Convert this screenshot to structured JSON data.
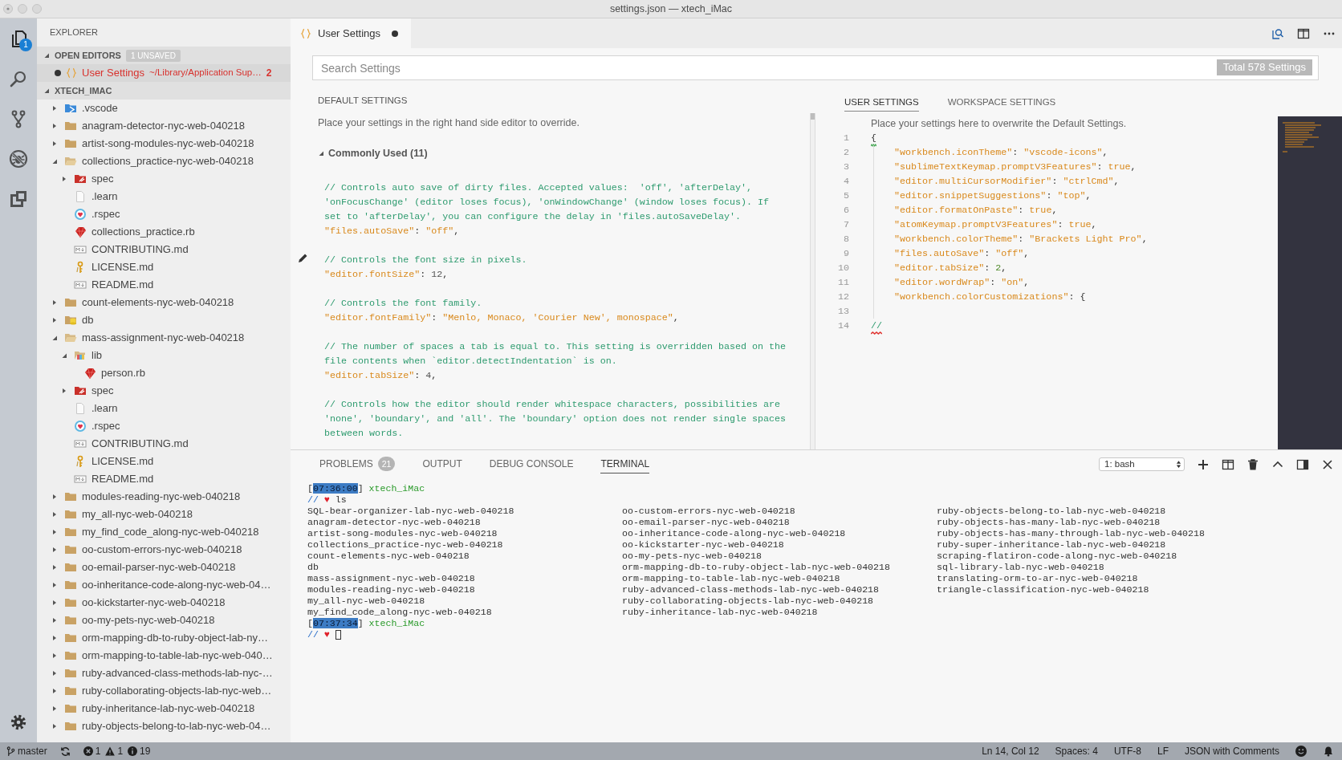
{
  "window": {
    "title": "settings.json — xtech_iMac"
  },
  "activity_bar": {
    "items": [
      {
        "kind": "explorer",
        "selected": true,
        "badge": "1"
      },
      {
        "kind": "search",
        "selected": false
      },
      {
        "kind": "source-control",
        "selected": false
      },
      {
        "kind": "debug",
        "selected": false
      },
      {
        "kind": "extensions",
        "selected": false
      }
    ]
  },
  "sidebar": {
    "title": "EXPLORER",
    "open_editors": {
      "label": "OPEN EDITORS",
      "expanded": true,
      "badge": "1 UNSAVED",
      "items": [
        {
          "name": "User Settings",
          "path": "~/Library/Application Sup…",
          "problems": "2",
          "dirty": true,
          "selected": true
        }
      ]
    },
    "folder": {
      "label": "XTECH_IMAC",
      "expanded": true,
      "items": [
        {
          "name": ".vscode",
          "kind": "vscode-folder",
          "expanded": false
        },
        {
          "name": "anagram-detector-nyc-web-040218",
          "kind": "folder",
          "expanded": false
        },
        {
          "name": "artist-song-modules-nyc-web-040218",
          "kind": "folder",
          "expanded": false
        },
        {
          "name": "collections_practice-nyc-web-040218",
          "kind": "folder",
          "expanded": true,
          "children": [
            {
              "name": "spec",
              "kind": "spec-folder",
              "expanded": false
            },
            {
              "name": ".learn",
              "kind": "file"
            },
            {
              "name": ".rspec",
              "kind": "rspec"
            },
            {
              "name": "collections_practice.rb",
              "kind": "ruby"
            },
            {
              "name": "CONTRIBUTING.md",
              "kind": "markdown"
            },
            {
              "name": "LICENSE.md",
              "kind": "license"
            },
            {
              "name": "README.md",
              "kind": "markdown"
            }
          ]
        },
        {
          "name": "count-elements-nyc-web-040218",
          "kind": "folder",
          "expanded": false
        },
        {
          "name": "db",
          "kind": "db-folder",
          "expanded": false
        },
        {
          "name": "mass-assignment-nyc-web-040218",
          "kind": "folder",
          "expanded": true,
          "children": [
            {
              "name": "lib",
              "kind": "lib-folder",
              "expanded": true,
              "children": [
                {
                  "name": "person.rb",
                  "kind": "ruby"
                }
              ]
            },
            {
              "name": "spec",
              "kind": "spec-folder",
              "expanded": false
            },
            {
              "name": ".learn",
              "kind": "file"
            },
            {
              "name": ".rspec",
              "kind": "rspec"
            },
            {
              "name": "CONTRIBUTING.md",
              "kind": "markdown"
            },
            {
              "name": "LICENSE.md",
              "kind": "license"
            },
            {
              "name": "README.md",
              "kind": "markdown"
            }
          ]
        },
        {
          "name": "modules-reading-nyc-web-040218",
          "kind": "folder",
          "expanded": false
        },
        {
          "name": "my_all-nyc-web-040218",
          "kind": "folder",
          "expanded": false
        },
        {
          "name": "my_find_code_along-nyc-web-040218",
          "kind": "folder",
          "expanded": false
        },
        {
          "name": "oo-custom-errors-nyc-web-040218",
          "kind": "folder",
          "expanded": false
        },
        {
          "name": "oo-email-parser-nyc-web-040218",
          "kind": "folder",
          "expanded": false
        },
        {
          "name": "oo-inheritance-code-along-nyc-web-04…",
          "kind": "folder",
          "expanded": false
        },
        {
          "name": "oo-kickstarter-nyc-web-040218",
          "kind": "folder",
          "expanded": false
        },
        {
          "name": "oo-my-pets-nyc-web-040218",
          "kind": "folder",
          "expanded": false
        },
        {
          "name": "orm-mapping-db-to-ruby-object-lab-ny…",
          "kind": "folder",
          "expanded": false
        },
        {
          "name": "orm-mapping-to-table-lab-nyc-web-040…",
          "kind": "folder",
          "expanded": false
        },
        {
          "name": "ruby-advanced-class-methods-lab-nyc-…",
          "kind": "folder",
          "expanded": false
        },
        {
          "name": "ruby-collaborating-objects-lab-nyc-web…",
          "kind": "folder",
          "expanded": false
        },
        {
          "name": "ruby-inheritance-lab-nyc-web-040218",
          "kind": "folder",
          "expanded": false
        },
        {
          "name": "ruby-objects-belong-to-lab-nyc-web-04…",
          "kind": "folder",
          "expanded": false
        }
      ]
    }
  },
  "editor": {
    "tabs": [
      {
        "label": "User Settings",
        "dirty": true,
        "selected": true
      }
    ],
    "search": {
      "placeholder": "Search Settings",
      "count": "Total 578 Settings"
    },
    "default_settings": {
      "title": "DEFAULT SETTINGS",
      "hint": "Place your settings in the right hand side editor to override.",
      "group": {
        "label": "Commonly Used (11)",
        "expanded": true
      },
      "blocks": [
        {
          "comment": [
            "// Controls auto save of dirty files. Accepted values:  'off', 'afterDelay',",
            "'onFocusChange' (editor loses focus), 'onWindowChange' (window loses focus). If",
            "set to 'afterDelay', you can configure the delay in 'files.autoSaveDelay'."
          ],
          "setting": [
            {
              "kind": "key",
              "text": "\"files.autoSave\""
            },
            {
              "kind": "punct",
              "text": ": "
            },
            {
              "kind": "string",
              "text": "\"off\""
            },
            {
              "kind": "punct",
              "text": ","
            }
          ]
        },
        {
          "comment": [
            "// Controls the font size in pixels."
          ],
          "setting": [
            {
              "kind": "key",
              "text": "\"editor.fontSize\""
            },
            {
              "kind": "punct",
              "text": ": "
            },
            {
              "kind": "plain",
              "text": "12"
            },
            {
              "kind": "punct",
              "text": ","
            }
          ]
        },
        {
          "comment": [
            "// Controls the font family."
          ],
          "setting": [
            {
              "kind": "key",
              "text": "\"editor.fontFamily\""
            },
            {
              "kind": "punct",
              "text": ": "
            },
            {
              "kind": "string",
              "text": "\"Menlo, Monaco, 'Courier New', monospace\""
            },
            {
              "kind": "punct",
              "text": ","
            }
          ]
        },
        {
          "comment": [
            "// The number of spaces a tab is equal to. This setting is overridden based on the",
            "file contents when `editor.detectIndentation` is on."
          ],
          "setting": [
            {
              "kind": "key",
              "text": "\"editor.tabSize\""
            },
            {
              "kind": "punct",
              "text": ": "
            },
            {
              "kind": "plain",
              "text": "4"
            },
            {
              "kind": "punct",
              "text": ","
            }
          ]
        },
        {
          "comment": [
            "// Controls how the editor should render whitespace characters, possibilities are",
            "'none', 'boundary', and 'all'. The 'boundary' option does not render single spaces",
            "between words."
          ]
        }
      ]
    },
    "user_settings": {
      "tabs": [
        {
          "label": "USER SETTINGS",
          "selected": true
        },
        {
          "label": "WORKSPACE SETTINGS",
          "selected": false
        }
      ],
      "hint": "Place your settings here to overwrite the Default Settings.",
      "lines": [
        {
          "number": "1",
          "indented": false,
          "tokens": [
            {
              "kind": "punct",
              "text": "{",
              "warning": true
            }
          ]
        },
        {
          "number": "2",
          "indented": true,
          "tokens": [
            {
              "kind": "key",
              "text": "\"workbench.iconTheme\""
            },
            {
              "kind": "punct",
              "text": ": "
            },
            {
              "kind": "string",
              "text": "\"vscode-icons\""
            },
            {
              "kind": "punct",
              "text": ","
            }
          ]
        },
        {
          "number": "3",
          "indented": true,
          "tokens": [
            {
              "kind": "key",
              "text": "\"sublimeTextKeymap.promptV3Features\""
            },
            {
              "kind": "punct",
              "text": ": "
            },
            {
              "kind": "bool",
              "text": "true"
            },
            {
              "kind": "punct",
              "text": ","
            }
          ]
        },
        {
          "number": "4",
          "indented": true,
          "tokens": [
            {
              "kind": "key",
              "text": "\"editor.multiCursorModifier\""
            },
            {
              "kind": "punct",
              "text": ": "
            },
            {
              "kind": "string",
              "text": "\"ctrlCmd\""
            },
            {
              "kind": "punct",
              "text": ","
            }
          ]
        },
        {
          "number": "5",
          "indented": true,
          "tokens": [
            {
              "kind": "key",
              "text": "\"editor.snippetSuggestions\""
            },
            {
              "kind": "punct",
              "text": ": "
            },
            {
              "kind": "string",
              "text": "\"top\""
            },
            {
              "kind": "punct",
              "text": ","
            }
          ]
        },
        {
          "number": "6",
          "indented": true,
          "tokens": [
            {
              "kind": "key",
              "text": "\"editor.formatOnPaste\""
            },
            {
              "kind": "punct",
              "text": ": "
            },
            {
              "kind": "bool",
              "text": "true"
            },
            {
              "kind": "punct",
              "text": ","
            }
          ]
        },
        {
          "number": "7",
          "indented": true,
          "tokens": [
            {
              "kind": "key",
              "text": "\"atomKeymap.promptV3Features\""
            },
            {
              "kind": "punct",
              "text": ": "
            },
            {
              "kind": "bool",
              "text": "true"
            },
            {
              "kind": "punct",
              "text": ","
            }
          ]
        },
        {
          "number": "8",
          "indented": true,
          "tokens": [
            {
              "kind": "key",
              "text": "\"workbench.colorTheme\""
            },
            {
              "kind": "punct",
              "text": ": "
            },
            {
              "kind": "string",
              "text": "\"Brackets Light Pro\""
            },
            {
              "kind": "punct",
              "text": ","
            }
          ]
        },
        {
          "number": "9",
          "indented": true,
          "tokens": [
            {
              "kind": "key",
              "text": "\"files.autoSave\""
            },
            {
              "kind": "punct",
              "text": ": "
            },
            {
              "kind": "string",
              "text": "\"off\""
            },
            {
              "kind": "punct",
              "text": ","
            }
          ]
        },
        {
          "number": "10",
          "indented": true,
          "tokens": [
            {
              "kind": "key",
              "text": "\"editor.tabSize\""
            },
            {
              "kind": "punct",
              "text": ": "
            },
            {
              "kind": "number",
              "text": "2"
            },
            {
              "kind": "punct",
              "text": ","
            }
          ]
        },
        {
          "number": "11",
          "indented": true,
          "tokens": [
            {
              "kind": "key",
              "text": "\"editor.wordWrap\""
            },
            {
              "kind": "punct",
              "text": ": "
            },
            {
              "kind": "string",
              "text": "\"on\""
            },
            {
              "kind": "punct",
              "text": ","
            }
          ]
        },
        {
          "number": "12",
          "indented": true,
          "tokens": [
            {
              "kind": "key",
              "text": "\"workbench.colorCustomizations\""
            },
            {
              "kind": "punct",
              "text": ": {"
            }
          ]
        },
        {
          "number": "13"
        },
        {
          "number": "14",
          "indented": false,
          "tokens": [
            {
              "kind": "comment",
              "text": "//",
              "error": true
            }
          ]
        }
      ]
    }
  },
  "panel": {
    "tabs": [
      {
        "label": "PROBLEMS",
        "badge": "21",
        "selected": false
      },
      {
        "label": "OUTPUT",
        "selected": false
      },
      {
        "label": "DEBUG CONSOLE",
        "selected": false
      },
      {
        "label": "TERMINAL",
        "selected": true
      }
    ],
    "terminal_select": "1: bash",
    "terminal": [
      {
        "kind": "header",
        "open": "[",
        "time": "07:36:00",
        "close": "]",
        "host": "xtech_iMac"
      },
      {
        "kind": "command",
        "prefix": "//",
        "symbol": "♥",
        "command": "ls",
        "cursor": false
      },
      {
        "kind": "listing",
        "columns": [
          [
            "SQL-bear-organizer-lab-nyc-web-040218",
            "anagram-detector-nyc-web-040218",
            "artist-song-modules-nyc-web-040218",
            "collections_practice-nyc-web-040218",
            "count-elements-nyc-web-040218",
            "db",
            "mass-assignment-nyc-web-040218",
            "modules-reading-nyc-web-040218",
            "my_all-nyc-web-040218",
            "my_find_code_along-nyc-web-040218"
          ],
          [
            "oo-custom-errors-nyc-web-040218",
            "oo-email-parser-nyc-web-040218",
            "oo-inheritance-code-along-nyc-web-040218",
            "oo-kickstarter-nyc-web-040218",
            "oo-my-pets-nyc-web-040218",
            "orm-mapping-db-to-ruby-object-lab-nyc-web-040218",
            "orm-mapping-to-table-lab-nyc-web-040218",
            "ruby-advanced-class-methods-lab-nyc-web-040218",
            "ruby-collaborating-objects-lab-nyc-web-040218",
            "ruby-inheritance-lab-nyc-web-040218"
          ],
          [
            "ruby-objects-belong-to-lab-nyc-web-040218",
            "ruby-objects-has-many-lab-nyc-web-040218",
            "ruby-objects-has-many-through-lab-nyc-web-040218",
            "ruby-super-inheritance-lab-nyc-web-040218",
            "scraping-flatiron-code-along-nyc-web-040218",
            "sql-library-lab-nyc-web-040218",
            "translating-orm-to-ar-nyc-web-040218",
            "triangle-classification-nyc-web-040218"
          ]
        ]
      },
      {
        "kind": "header",
        "open": "[",
        "time": "07:37:34",
        "close": "]",
        "host": "xtech_iMac"
      },
      {
        "kind": "command",
        "prefix": "//",
        "symbol": "♥",
        "cursor": true
      }
    ]
  },
  "status_bar": {
    "branch": "master",
    "errors": "1",
    "warnings": "1",
    "infos": "19",
    "right": [
      "Ln 14, Col 12",
      "Spaces: 4",
      "UTF-8",
      "LF",
      "JSON with Comments"
    ]
  }
}
